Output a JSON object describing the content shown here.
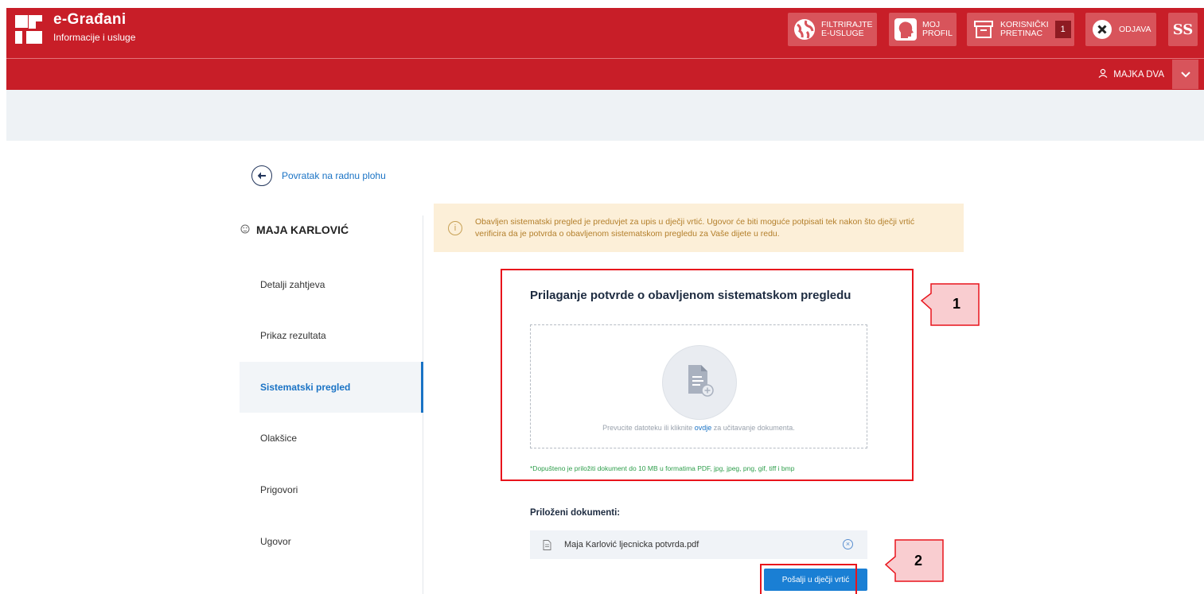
{
  "header": {
    "brand_title": "e-Građani",
    "brand_subtitle": "Informacije i usluge",
    "buttons": {
      "filter_line1": "FILTRIRAJTE",
      "filter_line2": "E-USLUGE",
      "profile_line1": "MOJ",
      "profile_line2": "PROFIL",
      "inbox_line1": "KORISNIČKI",
      "inbox_line2": "PRETINAC",
      "inbox_count": "1",
      "logout": "ODJAVA",
      "extra_glyph": "ß"
    },
    "user_name": "MAJKA DVA"
  },
  "back_link": "Povratak na radnu plohu",
  "sidebar": {
    "child_name": "MAJA KARLOVIĆ",
    "items": [
      {
        "label": "Detalji zahtjeva"
      },
      {
        "label": "Prikaz rezultata"
      },
      {
        "label": "Sistematski pregled"
      },
      {
        "label": "Olakšice"
      },
      {
        "label": "Prigovori"
      },
      {
        "label": "Ugovor"
      }
    ]
  },
  "info": {
    "text": "Obavljen sistematski pregled je preduvjet za upis u dječji vrtić. Ugovor će biti moguće potpisati tek nakon što dječji vrtić verificira da je potvrda o obavljenom sistematskom pregledu za Vaše dijete u redu."
  },
  "upload": {
    "title": "Prilaganje potvrde o obavljenom sistematskom pregledu",
    "drop_text_before": "Prevucite datoteku ili kliknite ",
    "drop_text_link": "ovdje",
    "drop_text_after": " za učitavanje dokumenta.",
    "allowed_note": "*Dopušteno je priložiti dokument do 10 MB u formatima PDF, jpg, jpeg, png, gif, tiff i bmp"
  },
  "attachments": {
    "title": "Priloženi dokumenti:",
    "files": [
      {
        "name": "Maja Karlović ljecnicka potvrda.pdf"
      }
    ]
  },
  "send_button": "Pošalji u dječji vrtić",
  "annotations": {
    "callout_1": "1",
    "callout_2": "2"
  },
  "colors": {
    "header_red": "#c81e28",
    "button_red": "#d8545b",
    "accent_blue": "#1a73c5",
    "info_bg": "#fcefd8",
    "annotation_red": "#e8141c",
    "callout_fill": "#f9cdd0"
  }
}
